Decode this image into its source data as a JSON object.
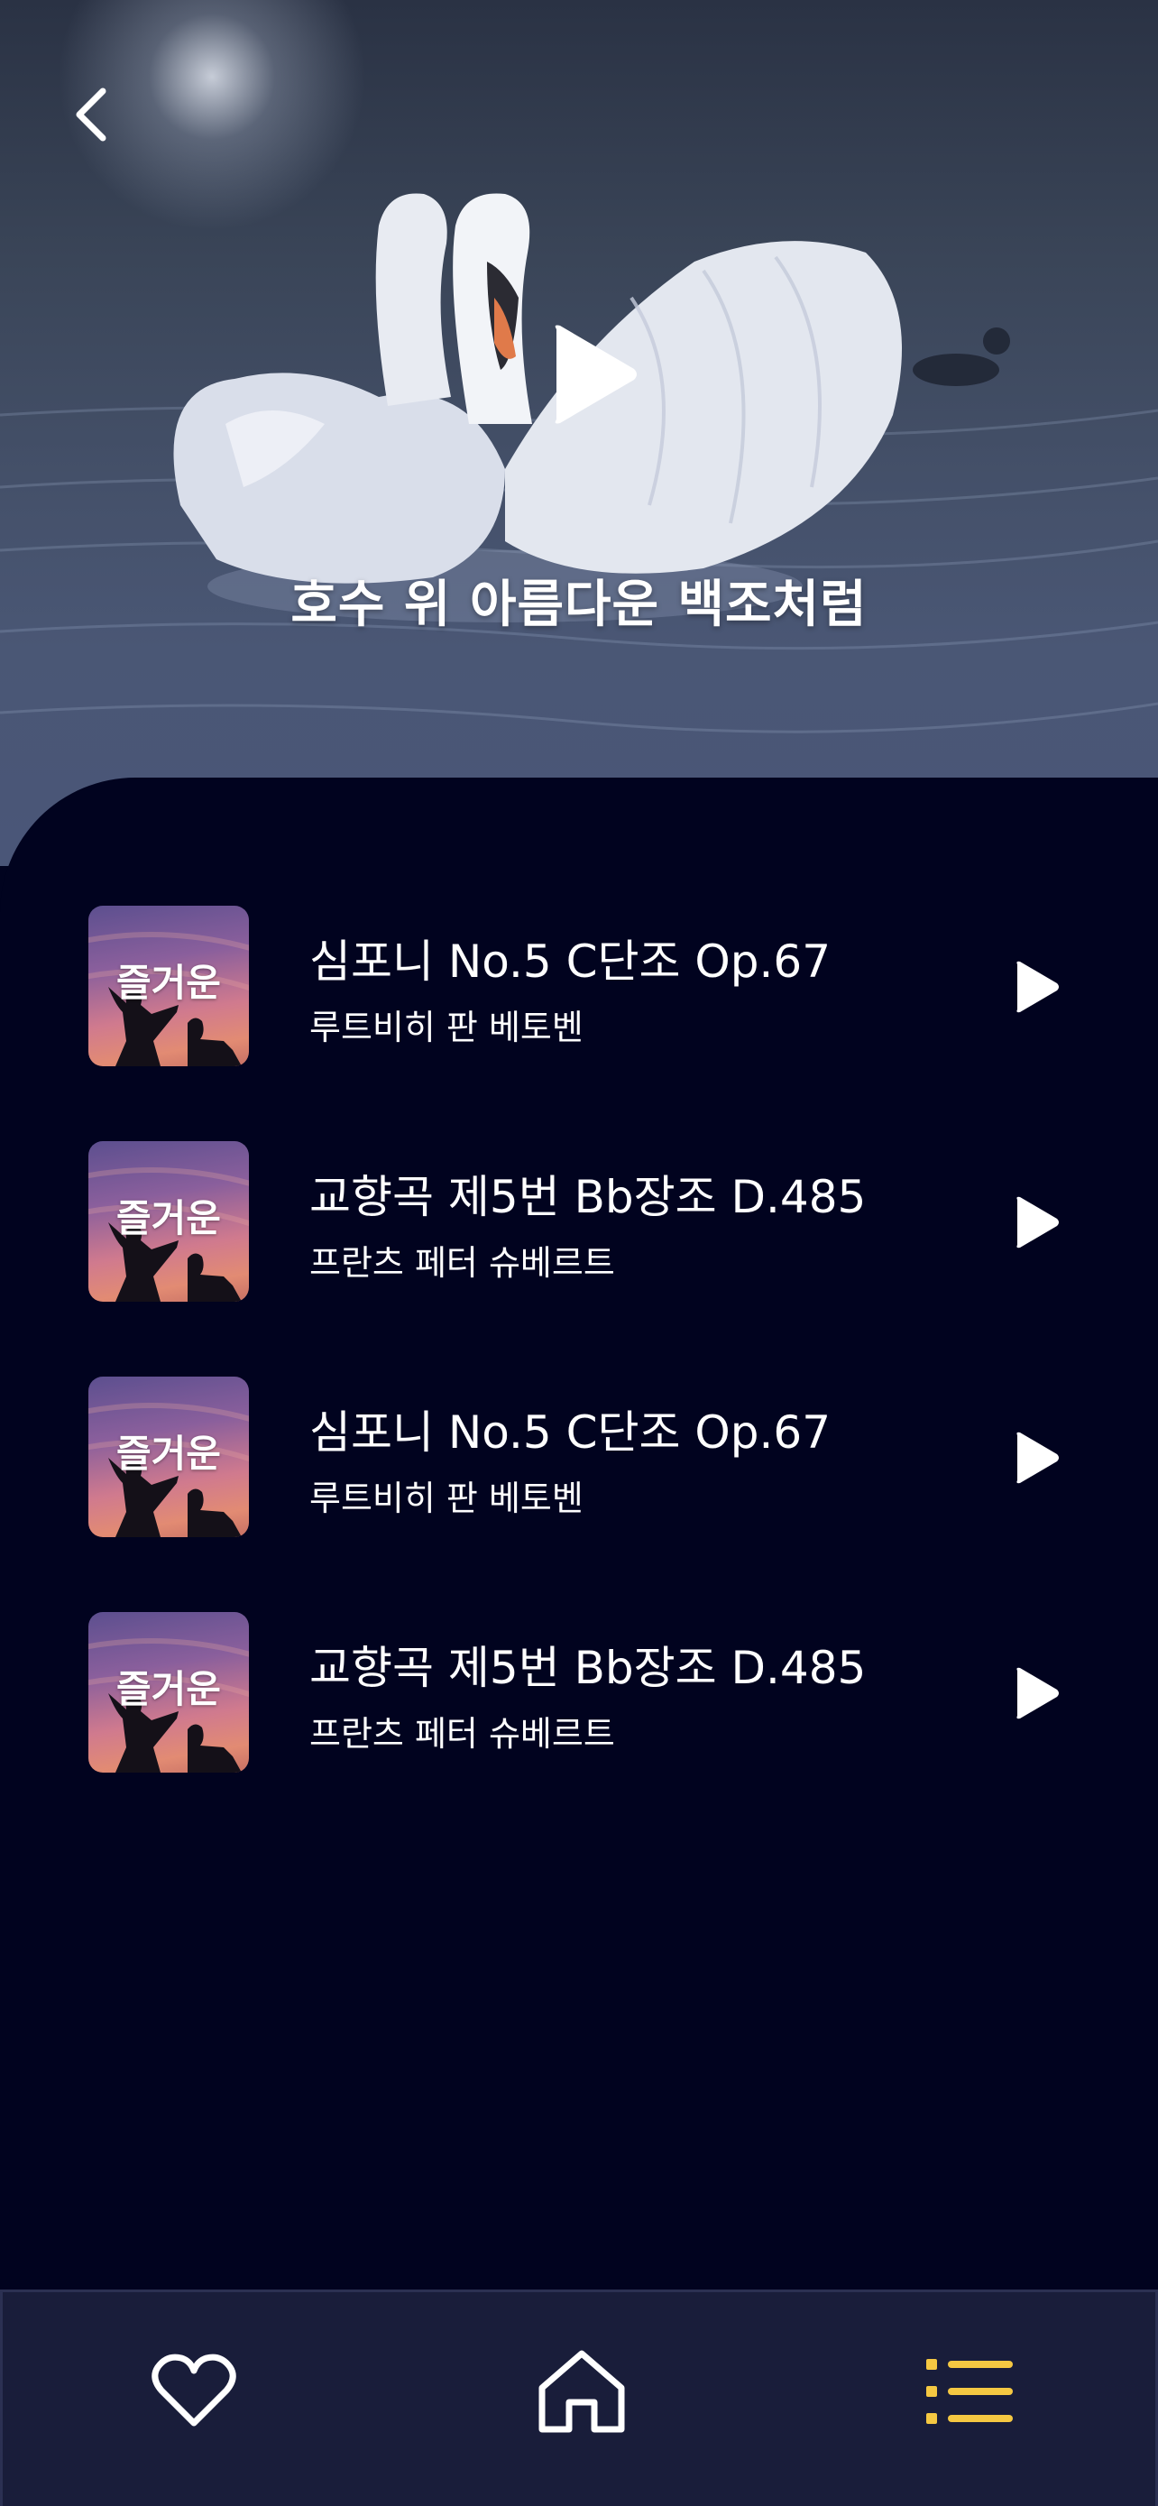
{
  "hero": {
    "title": "호수 위 아름다운 백조처럼",
    "back_icon": "chevron-left-icon",
    "play_icon": "play-icon"
  },
  "tracks": [
    {
      "thumb_label": "즐거운",
      "title": "심포니 No.5 C단조 Op.67",
      "artist": "루트비히 판 베토벤"
    },
    {
      "thumb_label": "즐거운",
      "title": "교향곡 제5번 Bb장조 D.485",
      "artist": "프란츠 페터 슈베르트"
    },
    {
      "thumb_label": "즐거운",
      "title": "심포니 No.5 C단조 Op.67",
      "artist": "루트비히 판 베토벤"
    },
    {
      "thumb_label": "즐거운",
      "title": "교향곡 제5번 Bb장조 D.485",
      "artist": "프란츠 페터 슈베르트"
    }
  ],
  "nav": {
    "items": [
      {
        "icon": "heart-icon",
        "active": false
      },
      {
        "icon": "home-icon",
        "active": false
      },
      {
        "icon": "list-icon",
        "active": true
      }
    ]
  },
  "colors": {
    "background": "#01031f",
    "nav_background": "#191d3a",
    "accent": "#f5c842",
    "text": "#ffffff"
  }
}
